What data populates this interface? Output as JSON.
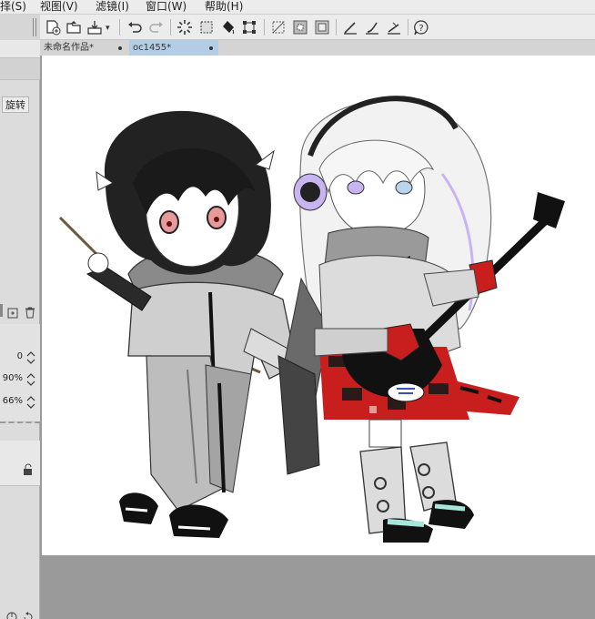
{
  "menu": {
    "items": [
      "择(S)",
      "视图(V)",
      "滤镜(I)",
      "窗口(W)",
      "帮助(H)"
    ]
  },
  "toolbar": {
    "icons": [
      "new-document-icon",
      "open-folder-icon",
      "save-icon",
      "undo-icon",
      "redo-icon",
      "loading-icon",
      "select-all-icon",
      "fill-icon",
      "transform-icon",
      "clear-selection-icon",
      "invert-selection-icon",
      "expand-selection-icon",
      "ruler-icon",
      "brush-stabilizer-icon",
      "angle-icon",
      "help-icon"
    ]
  },
  "left_panel": {
    "rotate_label": "旋转",
    "spinners": [
      {
        "value": "0"
      },
      {
        "value": "90%"
      },
      {
        "value": "66%"
      }
    ]
  },
  "tabs": [
    {
      "label": "未命名作品*",
      "active": false
    },
    {
      "label": "oc1455*",
      "active": true
    }
  ],
  "colors": {
    "accent": "#b4cde6",
    "red": "#c81e1e",
    "lilac": "#c8b4f0",
    "mint": "#a8e6dc"
  }
}
